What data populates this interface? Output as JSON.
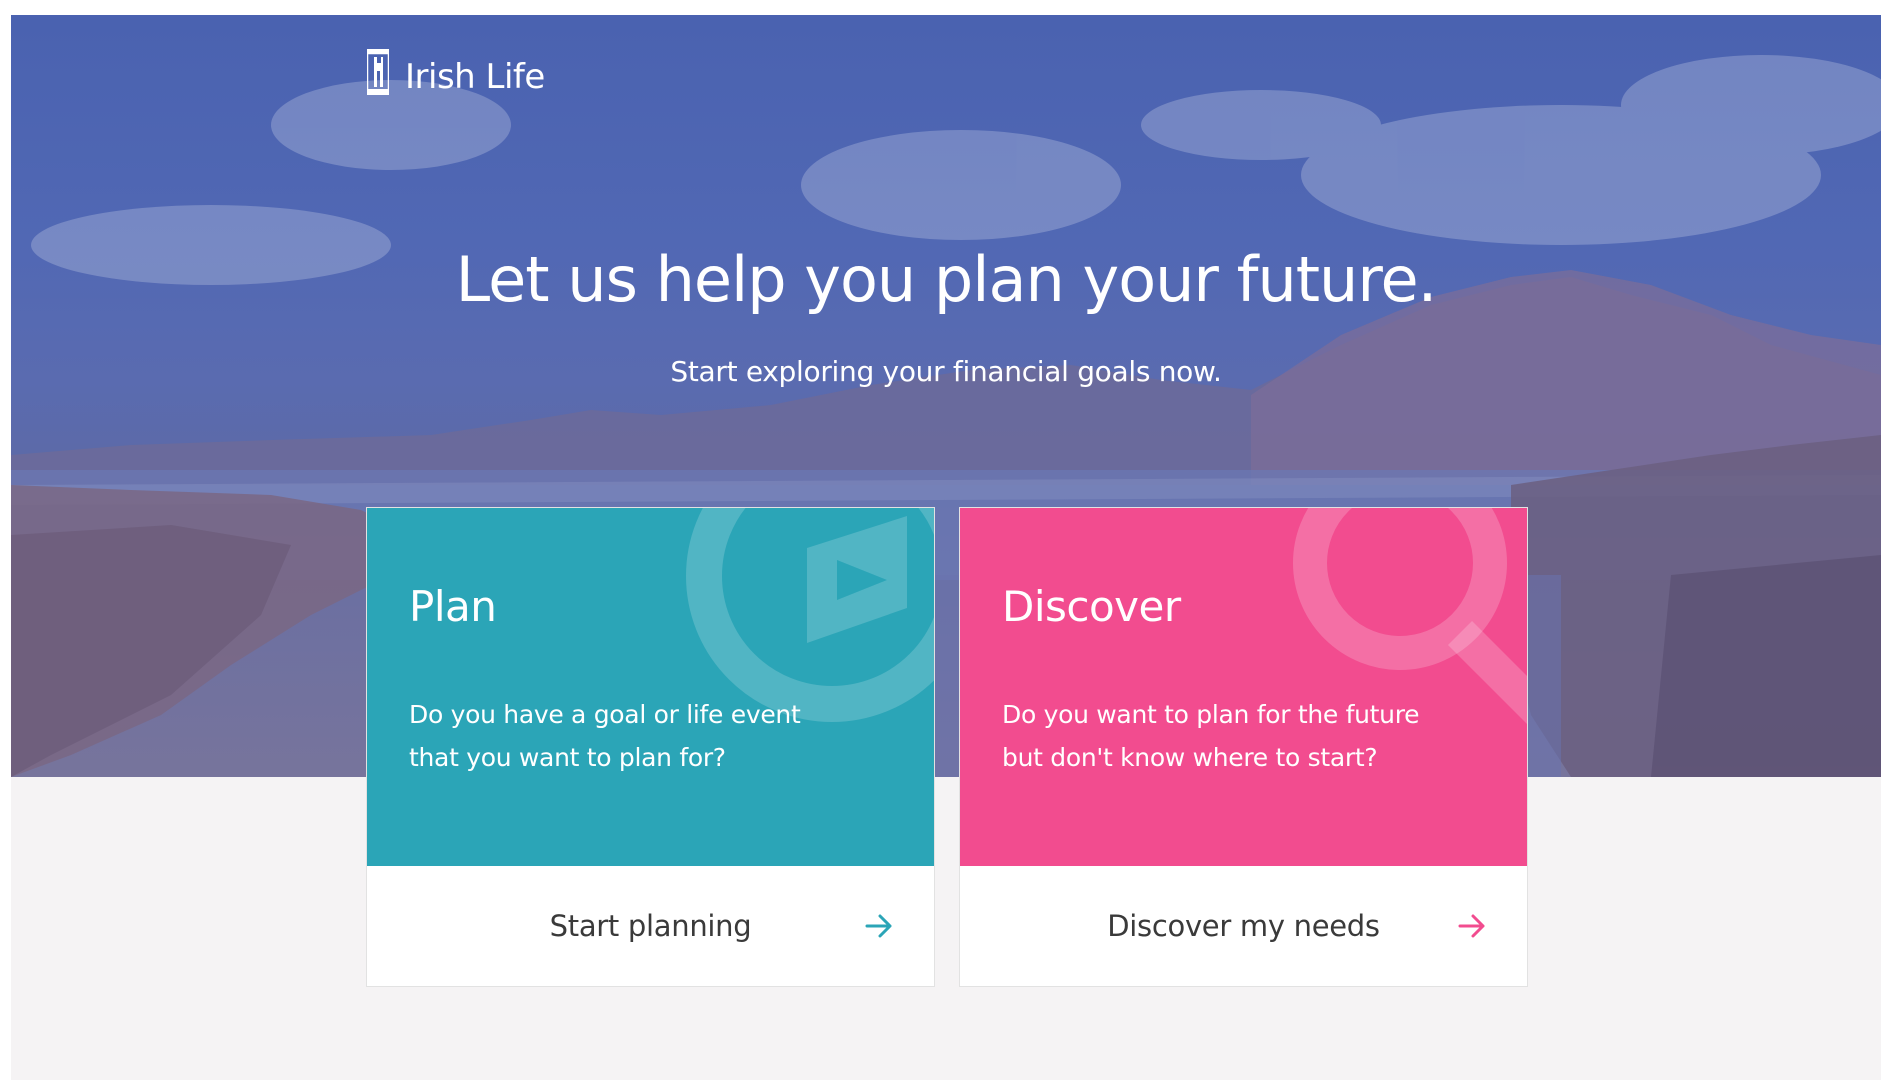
{
  "brand": {
    "name": "Irish Life",
    "icon": "irish-life-logo-icon"
  },
  "hero": {
    "title": "Let us help you plan your future.",
    "subtitle": "Start exploring your financial goals now."
  },
  "cards": {
    "plan": {
      "title": "Plan",
      "description": "Do you have a goal or life event that you want to plan for?",
      "action_label": "Start planning",
      "action_icon": "arrow-right-icon",
      "deco_icon": "play-target-icon",
      "color": "#2ba5b7"
    },
    "discover": {
      "title": "Discover",
      "description": "Do you want to plan for the future but don't know where to start?",
      "action_label": "Discover my needs",
      "action_icon": "arrow-right-icon",
      "deco_icon": "magnifier-icon",
      "color": "#f24c8f"
    }
  }
}
